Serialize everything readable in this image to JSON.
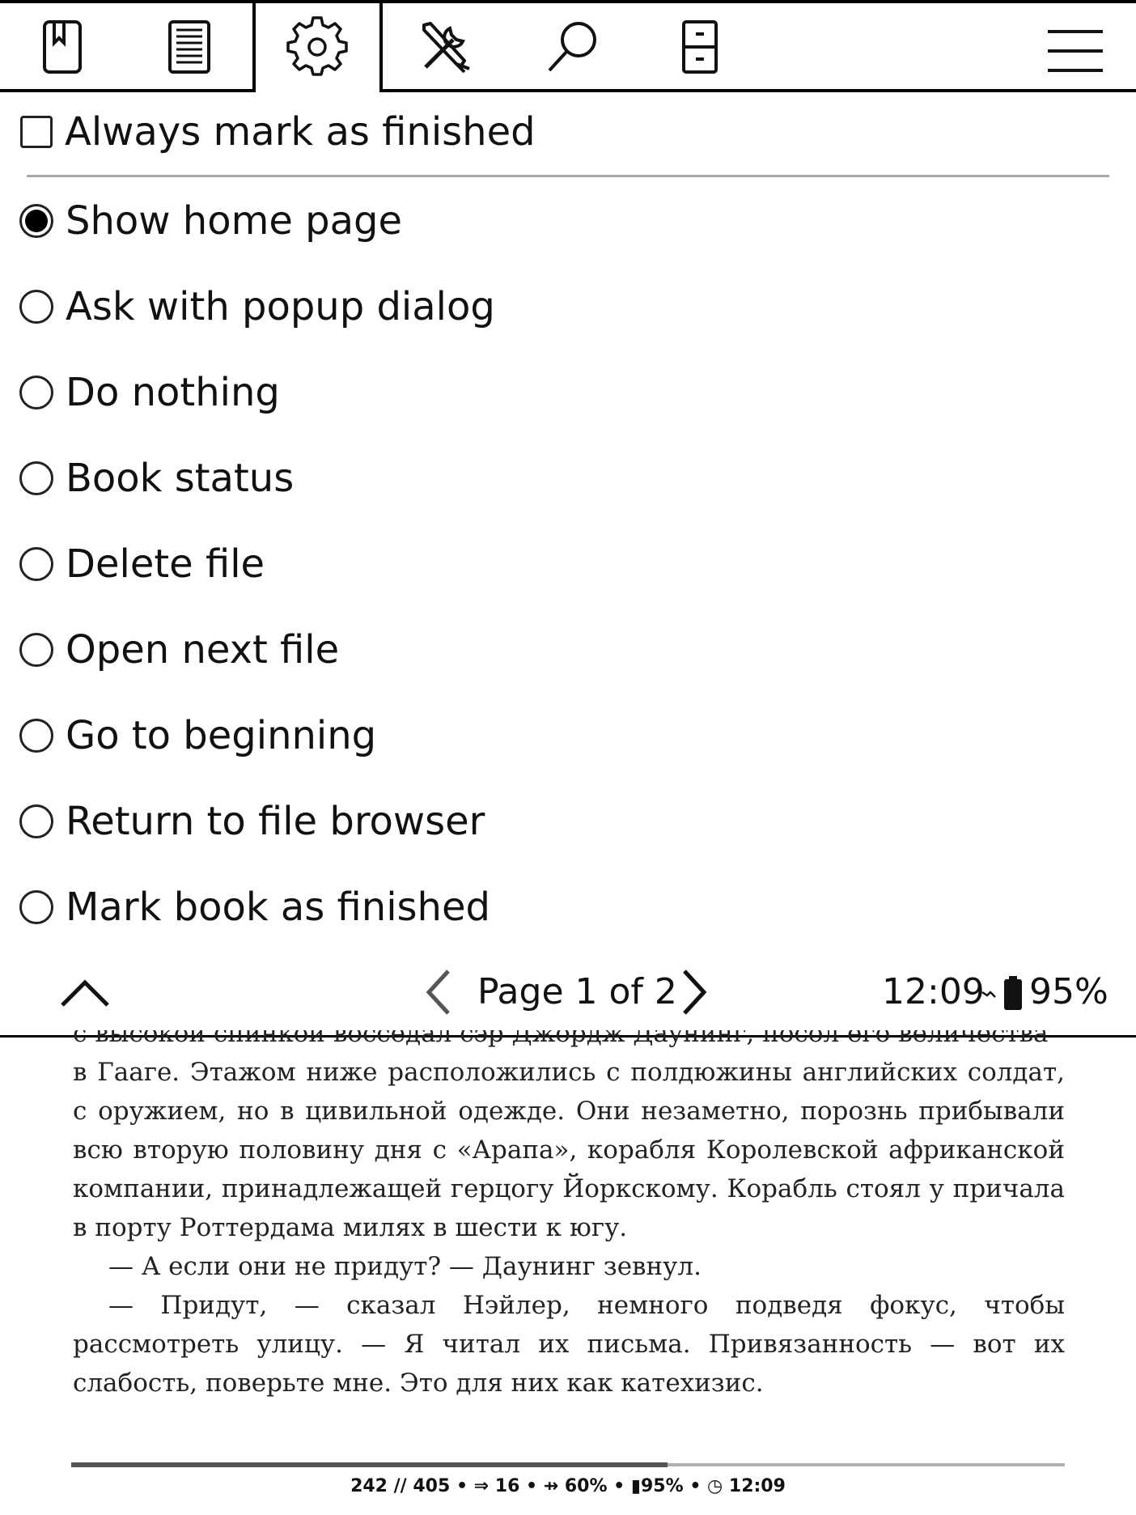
{
  "tabs": [
    {
      "name": "bookmark-tab",
      "icon": "bookmark-icon"
    },
    {
      "name": "toc-tab",
      "icon": "document-lines-icon"
    },
    {
      "name": "settings-tab",
      "icon": "gear-icon",
      "selected": true
    },
    {
      "name": "tools-tab",
      "icon": "tools-icon"
    },
    {
      "name": "search-tab",
      "icon": "search-icon"
    },
    {
      "name": "filing-tab",
      "icon": "cabinet-icon"
    },
    {
      "name": "main-menu",
      "icon": "hamburger-icon"
    }
  ],
  "menu": {
    "checkbox": {
      "label": "Always mark as finished",
      "checked": false
    },
    "options": [
      {
        "label": "Show home page",
        "selected": true
      },
      {
        "label": "Ask with popup dialog",
        "selected": false
      },
      {
        "label": "Do nothing",
        "selected": false
      },
      {
        "label": "Book status",
        "selected": false
      },
      {
        "label": "Delete file",
        "selected": false
      },
      {
        "label": "Open next file",
        "selected": false
      },
      {
        "label": "Go to beginning",
        "selected": false
      },
      {
        "label": "Return to file browser",
        "selected": false
      },
      {
        "label": "Mark book as finished",
        "selected": false
      }
    ],
    "footer": {
      "page_label": "Page 1 of 2",
      "time": "12:09",
      "battery": "95%"
    }
  },
  "book": {
    "clipped_line": "с высокой спинкой восседал сэр Джордж Даунинг, посол его величества",
    "paragraph1": "в Гааге. Этажом ниже расположились с полдюжины английских солдат, с оружием, но в цивильной одежде. Они незаметно, порознь прибывали всю вторую половину дня с «Арапа», корабля Королевской африканской компании, принадлежащей герцогу Йоркскому. Корабль стоял у причала в порту Роттердама милях в шести к югу.",
    "paragraph2": "— А если они не придут? — Даунинг зевнул.",
    "paragraph3": "— Придут, — сказал Нэйлер, немного подведя фокус, чтобы рассмотреть улицу. — Я читал их письма. Привязанность — вот их слабость, поверьте мне. Это для них как катехизис."
  },
  "status": {
    "progress_fraction": 0.6,
    "line": "242 // 405 • ⇒ 16 • ⇸ 60% • ▮95% • ◷ 12:09"
  }
}
